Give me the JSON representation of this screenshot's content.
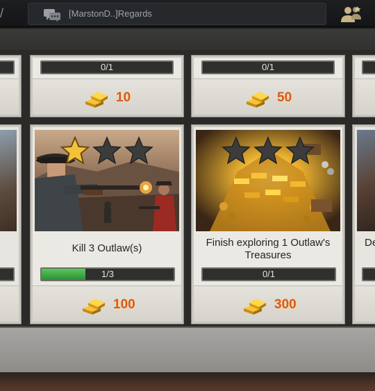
{
  "chat": {
    "message": "[MarstonD..]Regards",
    "icon": "chat-bubble-icon"
  },
  "header": {
    "friends_icon": "friends-icon"
  },
  "top_row": [
    {
      "progress_text": "0/1",
      "reward_value": "10",
      "reward_icon": "gold-bars-icon"
    },
    {
      "progress_text": "0/1",
      "reward_value": "50",
      "reward_icon": "gold-bars-icon"
    }
  ],
  "missions": [
    {
      "title": "Kill 3 Outlaw(s)",
      "progress_text": "1/3",
      "progress_fraction": 0.333,
      "stars_earned": 1,
      "stars_total": 3,
      "reward_value": "100",
      "reward_icon": "gold-bars-icon"
    },
    {
      "title": "Finish exploring 1 Outlaw's Treasures",
      "progress_text": "0/1",
      "progress_fraction": 0,
      "stars_earned": 0,
      "stars_total": 3,
      "reward_value": "300",
      "reward_icon": "gold-bars-icon"
    }
  ],
  "partial_right_card": {
    "title_fragment": "De"
  },
  "colors": {
    "reward_text": "#d85b16",
    "progress_fill": "#3fa843",
    "star_earned": "#f2c23a",
    "star_empty": "#3c3c3c"
  }
}
